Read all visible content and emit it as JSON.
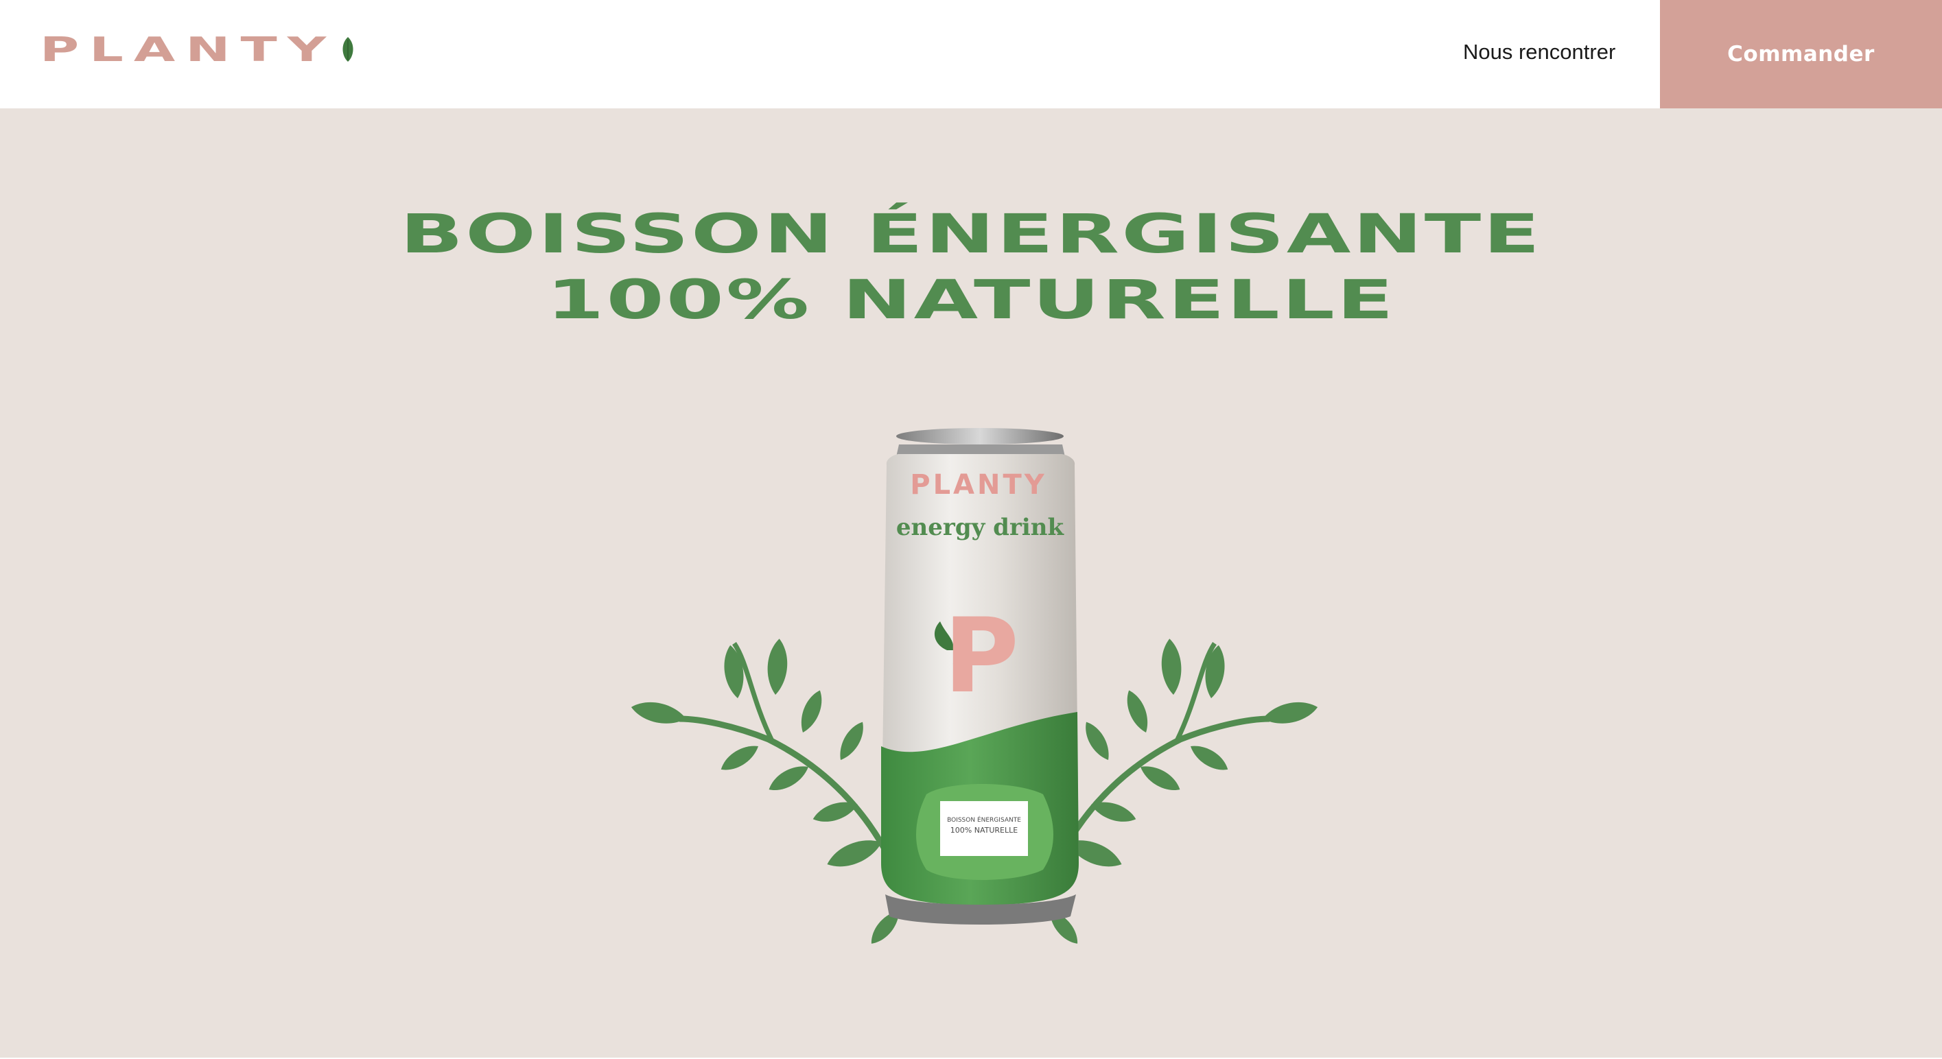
{
  "brand": {
    "name": "PLANTY",
    "logo_icon": "leaf-icon",
    "color": "#d39f95"
  },
  "nav": {
    "meet_label": "Nous rencontrer",
    "order_label": "Commander"
  },
  "hero": {
    "headline_line1": "BOISSON ÉNERGISANTE",
    "headline_line2": "100% NATURELLE",
    "headline_color": "#528c50",
    "background": "#e9e1dc"
  },
  "product": {
    "can_brand": "PLANTY",
    "can_subtitle": "energy drink",
    "can_letter": "P",
    "can_label_line1": "BOISSON ÉNERGISANTE",
    "can_label_line2": "100% NATURELLE"
  },
  "colors": {
    "accent": "#d3a198",
    "leaf_green": "#528c50",
    "header_bg": "#ffffff"
  }
}
